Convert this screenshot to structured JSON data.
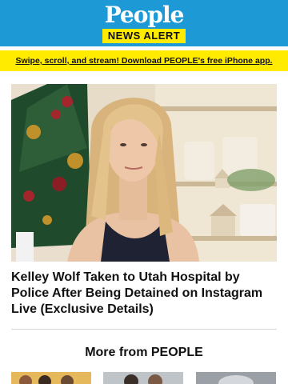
{
  "header": {
    "logo_text": "People",
    "badge": "NEWS ALERT",
    "bg_color": "#1d9ad6",
    "badge_color": "#ffeb00"
  },
  "promo": {
    "text": "Swipe, scroll, and stream! Download PEOPLE's free iPhone app."
  },
  "article": {
    "headline": "Kelley Wolf Taken to Utah Hospital by Police After Being Detained on Instagram Live (Exclusive Details)"
  },
  "more": {
    "title": "More from PEOPLE"
  }
}
